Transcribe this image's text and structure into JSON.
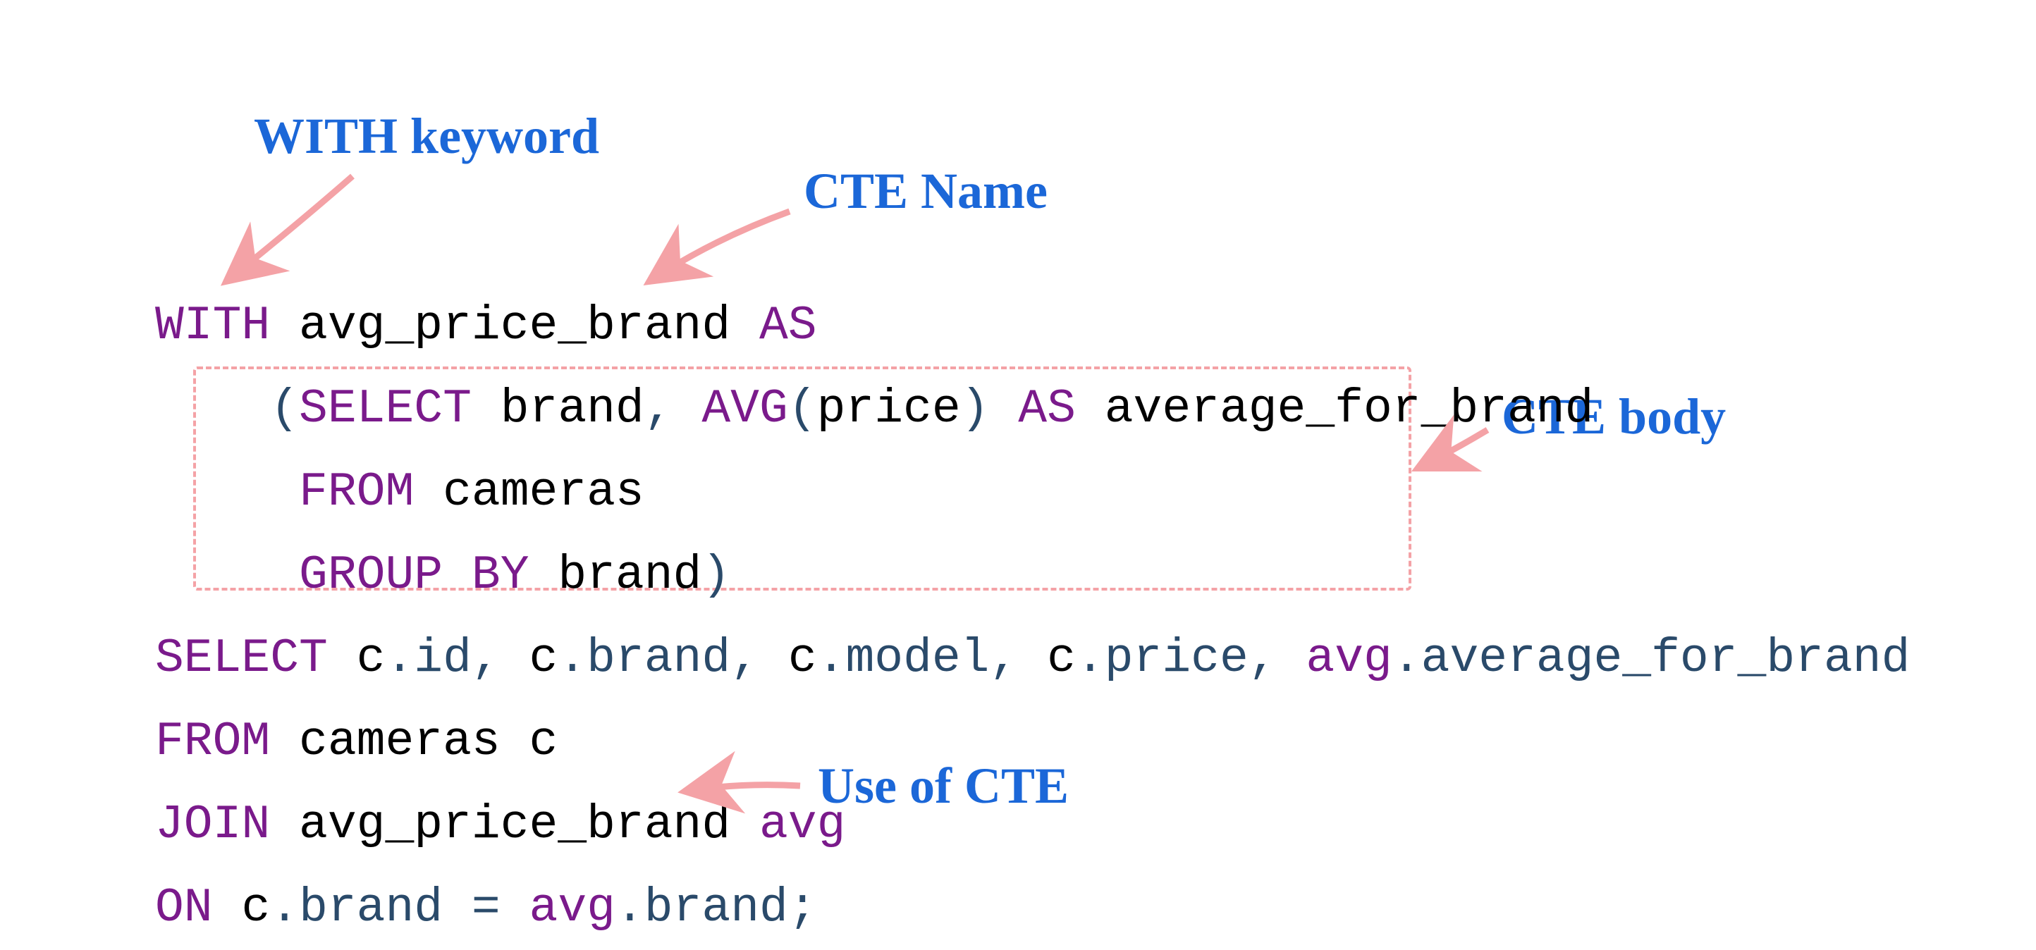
{
  "annotations": {
    "with_keyword": "WITH keyword",
    "cte_name": "CTE Name",
    "cte_body": "CTE body",
    "use_of_cte": "Use of CTE"
  },
  "sql": {
    "line1": {
      "with": "WITH",
      "name": "avg_price_brand",
      "as": "AS"
    },
    "line2": {
      "indent": "    ",
      "paren": "(",
      "select": "SELECT",
      "sp": " ",
      "brand": "brand",
      "comma": ",",
      "avg_func": "AVG",
      "open": "(",
      "price": "price",
      "close": ")",
      "as": "AS",
      "alias": "average_for_brand"
    },
    "line3": {
      "indent": "     ",
      "from": "FROM",
      "cameras": "cameras"
    },
    "line4": {
      "indent": "     ",
      "groupby": "GROUP BY",
      "brand": "brand",
      "close": ")"
    },
    "line5": {
      "select": "SELECT",
      "c": "c",
      "dot": ".",
      "id": "id",
      "comma": ",",
      "brand": "brand",
      "model": "model",
      "price": "price",
      "avg": "avg",
      "avg_for_brand": "average_for_brand"
    },
    "line6": {
      "from": "FROM",
      "cameras": "cameras",
      "alias": "c"
    },
    "line7": {
      "join": "JOIN",
      "name": "avg_price_brand",
      "alias": "avg"
    },
    "line8": {
      "on": "ON",
      "c": "c",
      "dot": ".",
      "brand": "brand",
      "eq": "=",
      "avg": "avg",
      "semi": ";"
    }
  },
  "colors": {
    "keyword": "#7a1a8b",
    "identifier": "#000000",
    "member": "#2a4a6a",
    "annotation": "#1b67d8",
    "arrow": "#f4a2a6",
    "dashbox": "#f4a2a6"
  }
}
